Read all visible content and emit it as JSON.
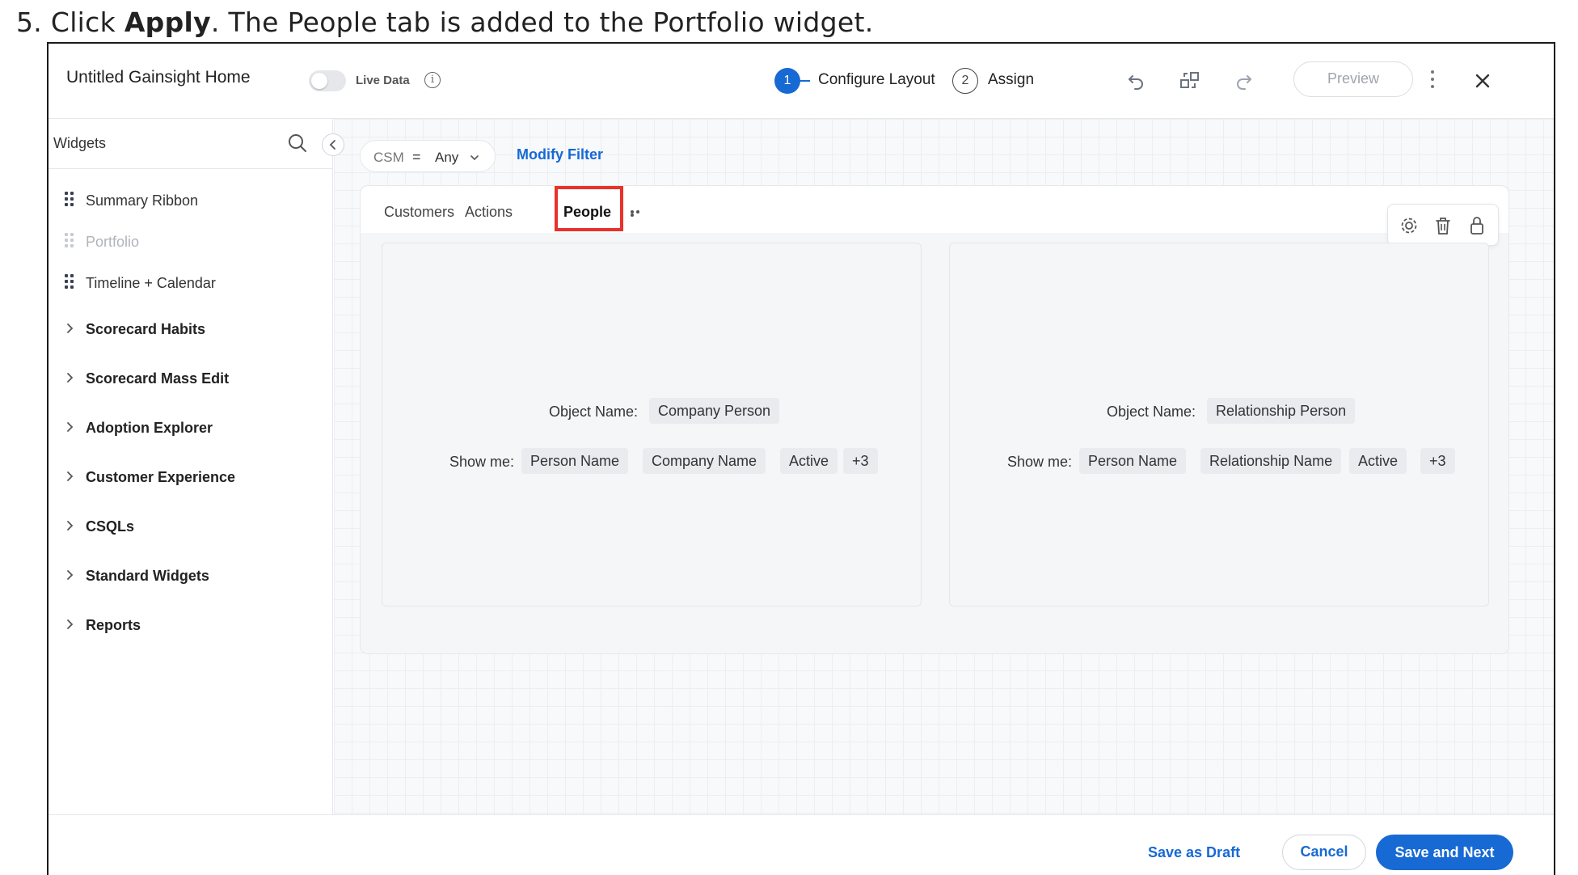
{
  "instruction": {
    "prefix": "5. Click ",
    "bold": "Apply",
    "suffix": ". The People tab is added to the Portfolio widget."
  },
  "header": {
    "title": "Untitled Gainsight Home",
    "live_data_label": "Live Data",
    "live_data_on": false,
    "info_icon": "i",
    "steps": [
      {
        "number": "1",
        "label": "Configure Layout",
        "active": true
      },
      {
        "number": "2",
        "label": "Assign",
        "active": false
      }
    ],
    "toolbar_icons": [
      "undo-icon",
      "swap-layout-icon",
      "redo-icon"
    ],
    "preview_label": "Preview",
    "more_icon": "kebab-icon",
    "close_icon": "close-icon"
  },
  "sidebar": {
    "title": "Widgets",
    "items": [
      {
        "label": "Summary Ribbon",
        "type": "widget",
        "disabled": false
      },
      {
        "label": "Portfolio",
        "type": "widget",
        "disabled": true
      },
      {
        "label": "Timeline + Calendar",
        "type": "widget",
        "disabled": false
      },
      {
        "label": "Scorecard Habits",
        "type": "group"
      },
      {
        "label": "Scorecard Mass Edit",
        "type": "group"
      },
      {
        "label": "Adoption Explorer",
        "type": "group"
      },
      {
        "label": "Customer Experience",
        "type": "group"
      },
      {
        "label": "CSQLs",
        "type": "group"
      },
      {
        "label": "Standard Widgets",
        "type": "group"
      },
      {
        "label": "Reports",
        "type": "group"
      }
    ]
  },
  "filter": {
    "field": "CSM",
    "operator": "=",
    "value": "Any",
    "modify_label": "Modify Filter"
  },
  "portfolio_widget": {
    "tabs": [
      {
        "label": "Customers",
        "active": false
      },
      {
        "label": "Actions",
        "active": false
      },
      {
        "label": "People",
        "active": true
      }
    ],
    "more_tabs_icon": "ellipsis-icon",
    "tools": [
      "settings-icon",
      "trash-icon",
      "lock-icon"
    ],
    "cards": [
      {
        "object_label": "Object Name:",
        "object_value": "Company Person",
        "show_label": "Show me:",
        "fields": [
          "Person Name",
          "Company Name",
          "Active",
          "+3"
        ]
      },
      {
        "object_label": "Object Name:",
        "object_value": "Relationship Person",
        "show_label": "Show me:",
        "fields": [
          "Person Name",
          "Relationship Name",
          "Active",
          "+3"
        ]
      }
    ]
  },
  "footer": {
    "save_draft_label": "Save as Draft",
    "cancel_label": "Cancel",
    "save_next_label": "Save and Next"
  },
  "colors": {
    "primary": "#1769d4",
    "highlight": "#e8322c",
    "chip_bg": "#e9ebef"
  }
}
